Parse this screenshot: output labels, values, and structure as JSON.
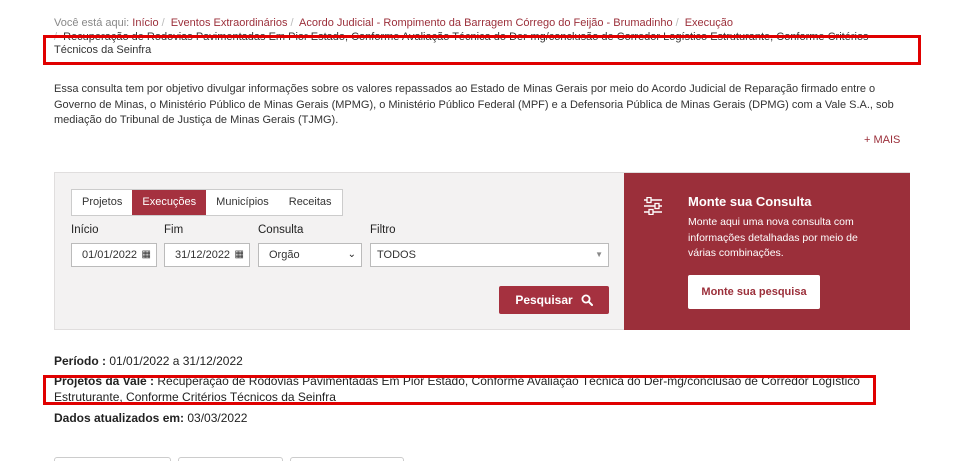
{
  "breadcrumb": {
    "label": "Você está aqui:",
    "items": [
      "Início",
      "Eventos Extraordinários",
      "Acordo Judicial - Rompimento da Barragem Córrego do Feijão - Brumadinho",
      "Execução"
    ],
    "current": "Recuperação de Rodovias Pavimentadas Em Pior Estado, Conforme Avaliação Técnica do Der-mg/conclusão de Corredor Logístico Estruturante, Conforme Critérios Técnicos da Seinfra"
  },
  "intro": "Essa consulta tem por objetivo divulgar informações sobre os valores repassados ao Estado de Minas Gerais por meio do Acordo Judicial de Reparação firmado entre o Governo de Minas, o Ministério Público de Minas Gerais (MPMG), o Ministério Público Federal (MPF) e a Defensoria Pública de Minas Gerais (DPMG) com a Vale S.A., sob mediação do Tribunal de Justiça de Minas Gerais (TJMG).",
  "more_link": "+ MAIS",
  "tabs": [
    {
      "label": "Projetos"
    },
    {
      "label": "Execuções"
    },
    {
      "label": "Municípios"
    },
    {
      "label": "Receitas"
    }
  ],
  "form": {
    "inicio_label": "Início",
    "inicio_value": "01/01/2022",
    "fim_label": "Fim",
    "fim_value": "31/12/2022",
    "consulta_label": "Consulta",
    "consulta_value": "Orgão",
    "filtro_label": "Filtro",
    "filtro_value": "TODOS",
    "search_button": "Pesquisar"
  },
  "side": {
    "title": "Monte sua Consulta",
    "desc": "Monte aqui uma nova consulta com informações detalhadas por meio de várias combinações.",
    "button": "Monte sua pesquisa"
  },
  "results": {
    "periodo_label": "Período :",
    "periodo_value": "01/01/2022 a 31/12/2022",
    "projetos_label": "Projetos da Vale :",
    "projetos_value": "Recuperação de Rodovias Pavimentadas Em Pior Estado, Conforme Avaliação Técnica do Der-mg/conclusão de Corredor Logístico Estruturante, Conforme Critérios Técnicos da Seinfra",
    "dados_label": "Dados atualizados em:",
    "dados_value": "03/03/2022"
  },
  "colors": {
    "accent": "#a5313f",
    "side_panel": "#9b2f3a",
    "highlight_box": "#e00000"
  },
  "icons": [
    "calendar-icon",
    "chevron-down-icon",
    "search-icon",
    "sliders-icon"
  ]
}
